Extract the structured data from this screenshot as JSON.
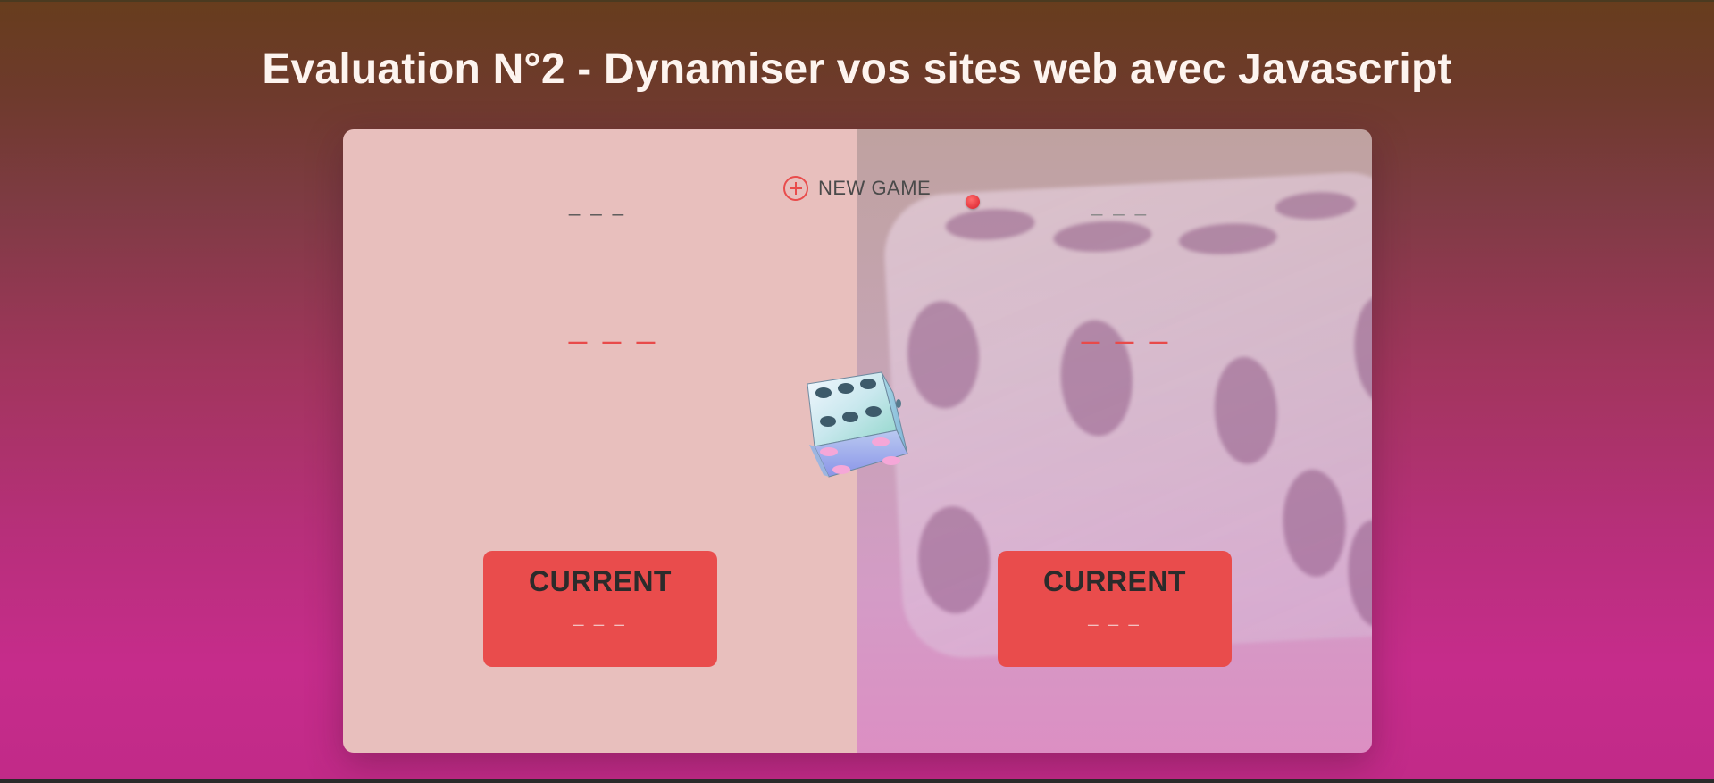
{
  "page": {
    "title": "Evaluation N°2 - Dynamiser vos sites web avec Javascript"
  },
  "players": [
    {
      "score": "_ _ _",
      "name": "_ _ _",
      "current_label": "CURRENT",
      "current_score": "_ _ _",
      "active": true
    },
    {
      "score": "_ _ _",
      "name": "_ _ _",
      "current_label": "CURRENT",
      "current_score": "_ _ _",
      "active": false
    }
  ],
  "controls": {
    "new_game_label": "NEW GAME",
    "new_game_icon": "plus-circle-icon"
  },
  "dice": {
    "icon": "dice-icon",
    "top_face_value": 6
  },
  "colors": {
    "accent": "#e94c4c",
    "title": "#fdf4ef",
    "left_panel": "#e8bfbd",
    "active_dot": "#d81e2a"
  }
}
